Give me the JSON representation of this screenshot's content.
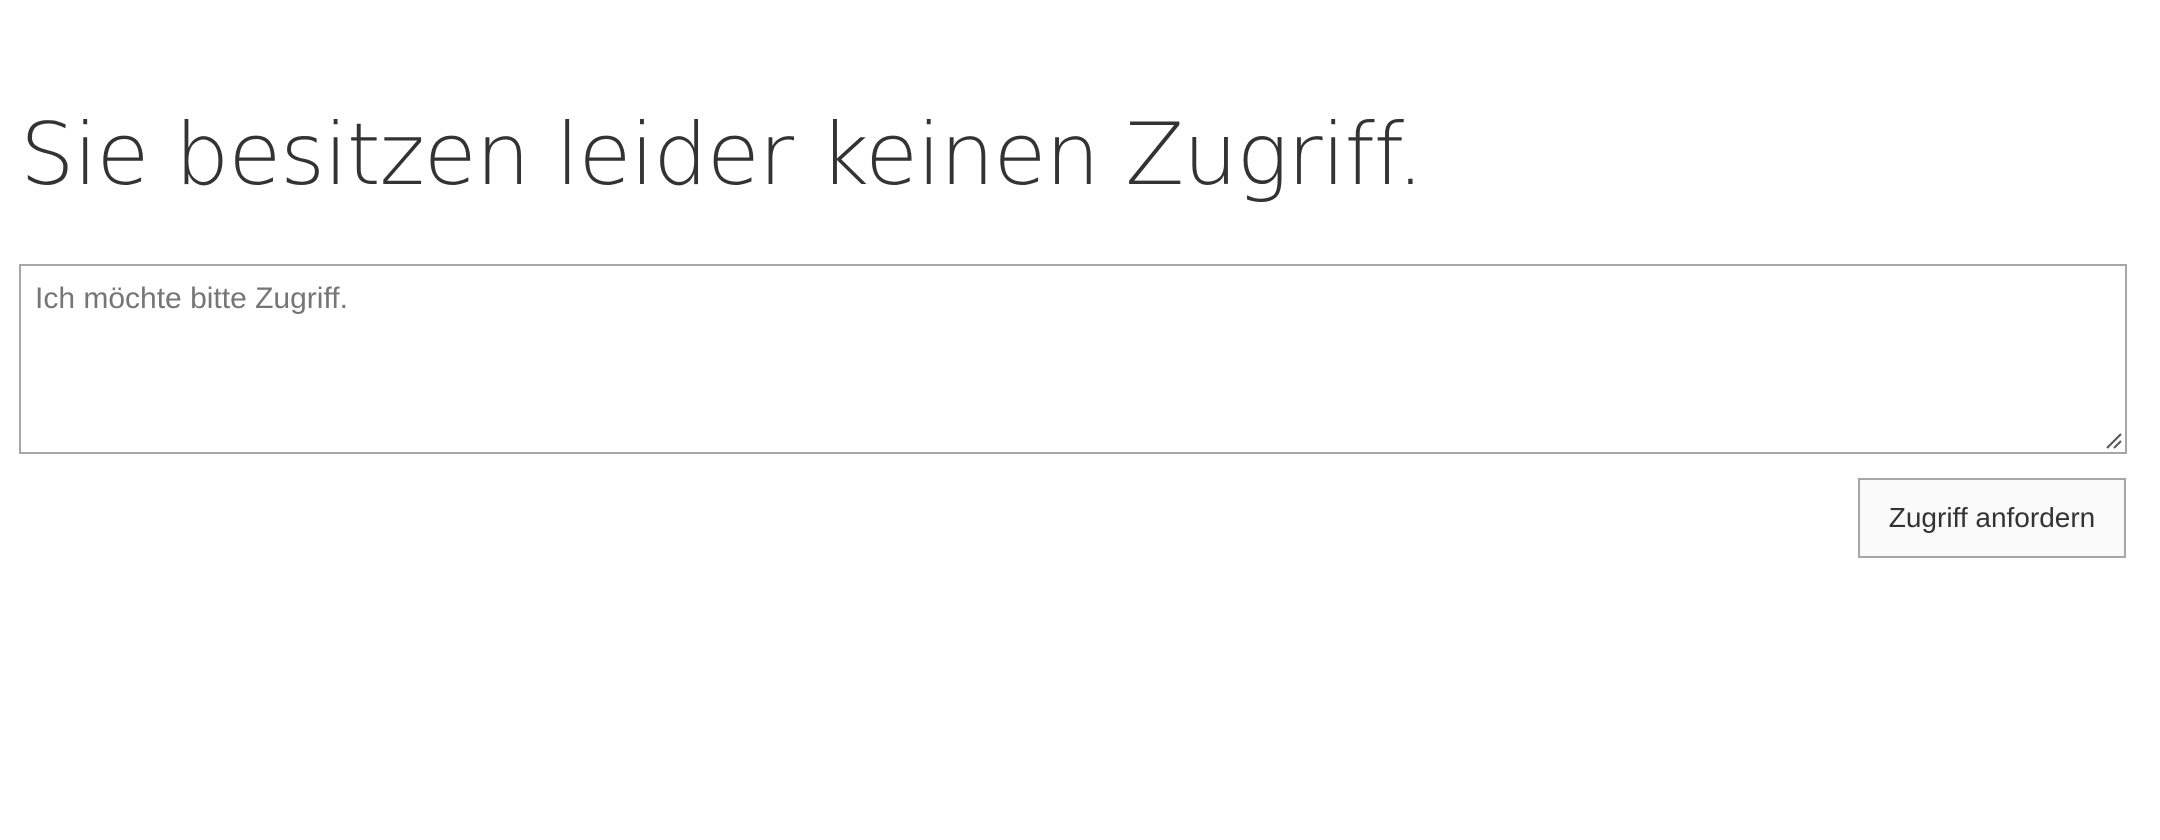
{
  "heading": {
    "text": "Sie besitzen leider keinen Zugriff."
  },
  "request_form": {
    "message_value": "",
    "message_placeholder": "Ich möchte bitte Zugriff.",
    "submit_label": "Zugriff anfordern"
  },
  "colors": {
    "heading_text": "#333333",
    "placeholder_text": "#767676",
    "border": "#a6a6a6",
    "button_background": "#fafafa"
  }
}
